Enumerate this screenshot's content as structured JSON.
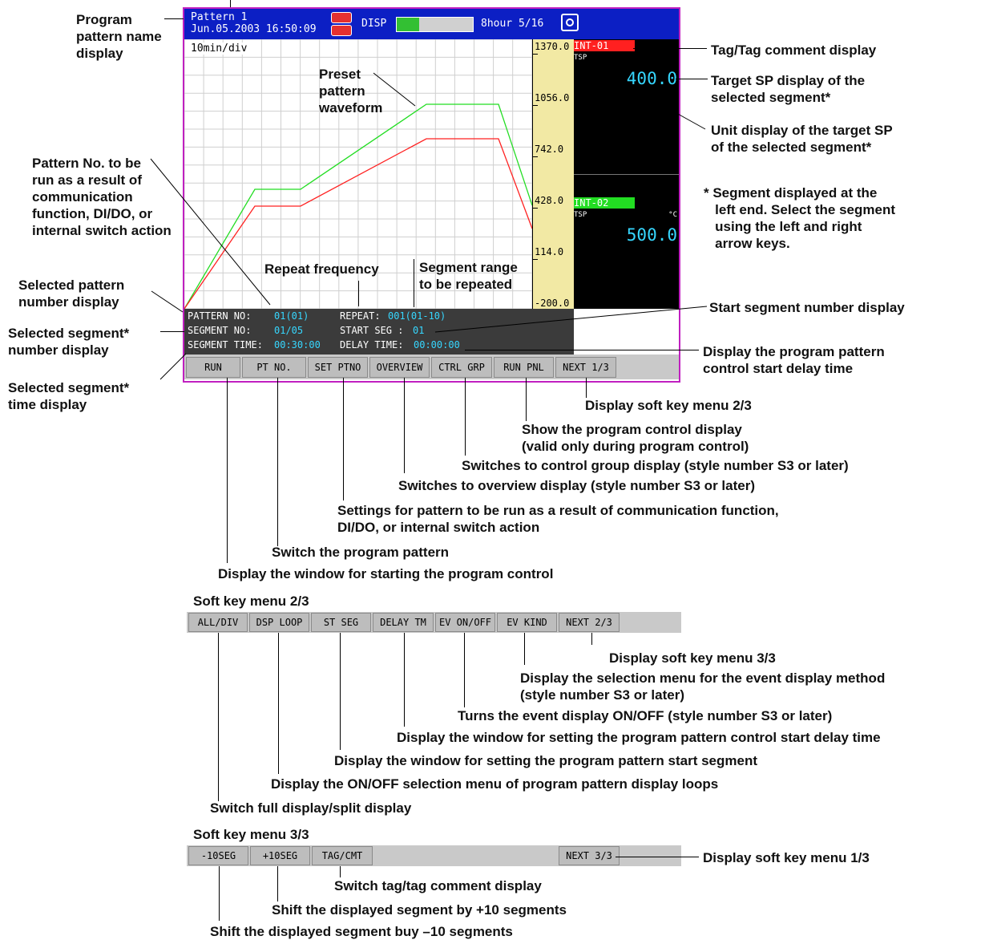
{
  "screen": {
    "header": {
      "pattern_name": "Pattern 1",
      "datetime": "Jun.05.2003 16:50:09",
      "disp_label": "DISP",
      "memory_info": "8hour 5/16"
    },
    "plot": {
      "time_div": "10min/div"
    },
    "scale": {
      "labels": [
        "1370.0",
        "1056.0",
        "742.0",
        "428.0",
        "114.0",
        "-200.0"
      ]
    },
    "tags": [
      {
        "tag": "INT-01",
        "tsp_label": "TSP",
        "unit": "",
        "value": "400.0",
        "color": "#ff2020"
      },
      {
        "tag": "INT-02",
        "tsp_label": "TSP",
        "unit": "°C",
        "value": "500.0",
        "color": "#22dd22"
      }
    ],
    "info": {
      "pattern_no_label": "PATTERN NO:",
      "pattern_no_value": "01(01)",
      "repeat_label": "REPEAT:",
      "repeat_value": "001(01-10)",
      "segment_no_label": "SEGMENT NO:",
      "segment_no_value": "01/05",
      "start_seg_label": "START SEG :",
      "start_seg_value": "01",
      "segment_time_label": "SEGMENT TIME:",
      "segment_time_value": "00:30:00",
      "delay_time_label": "DELAY TIME:",
      "delay_time_value": "00:00:00"
    },
    "softkeys_1": [
      "RUN",
      "PT NO.",
      "SET PTNO",
      "OVERVIEW",
      "CTRL GRP",
      "RUN PNL",
      "NEXT 1/3"
    ],
    "waveforms": [
      {
        "name": "INT-01",
        "color": "#ff2020"
      },
      {
        "name": "INT-02",
        "color": "#22dd22"
      }
    ]
  },
  "menu2": {
    "title": "Soft key menu 2/3",
    "keys": [
      "ALL/DIV",
      "DSP LOOP",
      "ST SEG",
      "DELAY TM",
      "EV ON/OFF",
      "EV KIND",
      "NEXT 2/3"
    ]
  },
  "menu3": {
    "title": "Soft key menu 3/3",
    "keys": [
      "-10SEG",
      "+10SEG",
      "TAG/CMT",
      "NEXT 3/3"
    ]
  },
  "annotations": {
    "program_pattern_name": "Program\npattern name\ndisplay",
    "tag_comment": "Tag/Tag comment display",
    "target_sp": "Target SP display of the\nselected segment*",
    "unit_display": "Unit display of the target SP\nof the selected segment*",
    "preset_pattern": "Preset\npattern\nwaveform",
    "pattern_no_run": "Pattern No. to be\nrun as a result of\ncommunication\nfunction, DI/DO, or\ninternal switch action",
    "segment_note": "* Segment displayed at the\n   left end. Select the segment\n   using the left and right\n   arrow keys.",
    "repeat_frequency": "Repeat frequency",
    "segment_range": "Segment range\nto be repeated",
    "selected_pattern_no": "Selected pattern\nnumber display",
    "start_segment_no": "Start segment number display",
    "selected_segment_no": "Selected segment*\nnumber display",
    "delay_time": "Display the program pattern\ncontrol start delay time",
    "selected_segment_time": "Selected segment*\ntime display",
    "m1_next": "Display soft key menu 2/3",
    "m1_runpnl": "Show the program control display\n(valid only during program control)",
    "m1_ctrlgrp": "Switches to control group display (style number S3 or later)",
    "m1_overview": "Switches to overview display (style number S3 or later)",
    "m1_setptno": "Settings for pattern to be run as a result of communication function,\nDI/DO, or internal switch action",
    "m1_ptno": "Switch the program pattern",
    "m1_run": "Display the window for starting the program control",
    "m2_next": "Display soft key menu 3/3",
    "m2_evkind": "Display the selection menu for the event display method\n(style number S3 or later)",
    "m2_evonoff": "Turns the event display ON/OFF (style number S3 or later)",
    "m2_delaytm": "Display the window for setting the program pattern control start delay time",
    "m2_stseg": "Display the window for setting the program pattern start segment",
    "m2_dsploop": "Display the ON/OFF selection menu of program pattern display loops",
    "m2_alldiv": "Switch full display/split display",
    "m3_next": "Display soft key menu 1/3",
    "m3_tagcmt": "Switch tag/tag comment display",
    "m3_plus10": "Shift the displayed segment by +10 segments",
    "m3_minus10": "Shift the displayed segment buy –10 segments"
  }
}
